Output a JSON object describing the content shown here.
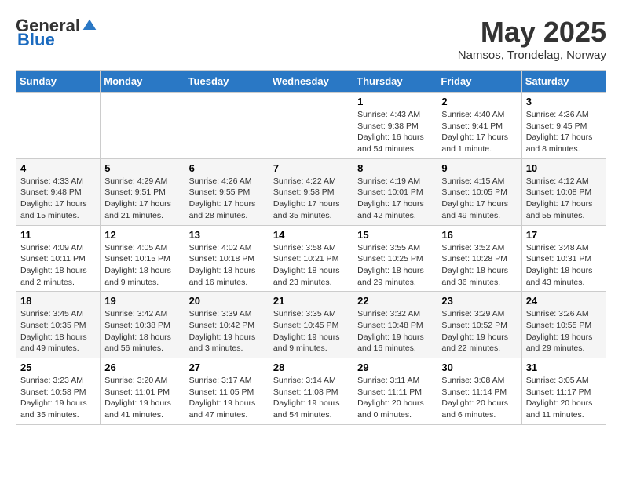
{
  "header": {
    "logo_general": "General",
    "logo_blue": "Blue",
    "month_title": "May 2025",
    "location": "Namsos, Trondelag, Norway"
  },
  "weekdays": [
    "Sunday",
    "Monday",
    "Tuesday",
    "Wednesday",
    "Thursday",
    "Friday",
    "Saturday"
  ],
  "weeks": [
    [
      {
        "day": "",
        "info": ""
      },
      {
        "day": "",
        "info": ""
      },
      {
        "day": "",
        "info": ""
      },
      {
        "day": "",
        "info": ""
      },
      {
        "day": "1",
        "info": "Sunrise: 4:43 AM\nSunset: 9:38 PM\nDaylight: 16 hours\nand 54 minutes."
      },
      {
        "day": "2",
        "info": "Sunrise: 4:40 AM\nSunset: 9:41 PM\nDaylight: 17 hours\nand 1 minute."
      },
      {
        "day": "3",
        "info": "Sunrise: 4:36 AM\nSunset: 9:45 PM\nDaylight: 17 hours\nand 8 minutes."
      }
    ],
    [
      {
        "day": "4",
        "info": "Sunrise: 4:33 AM\nSunset: 9:48 PM\nDaylight: 17 hours\nand 15 minutes."
      },
      {
        "day": "5",
        "info": "Sunrise: 4:29 AM\nSunset: 9:51 PM\nDaylight: 17 hours\nand 21 minutes."
      },
      {
        "day": "6",
        "info": "Sunrise: 4:26 AM\nSunset: 9:55 PM\nDaylight: 17 hours\nand 28 minutes."
      },
      {
        "day": "7",
        "info": "Sunrise: 4:22 AM\nSunset: 9:58 PM\nDaylight: 17 hours\nand 35 minutes."
      },
      {
        "day": "8",
        "info": "Sunrise: 4:19 AM\nSunset: 10:01 PM\nDaylight: 17 hours\nand 42 minutes."
      },
      {
        "day": "9",
        "info": "Sunrise: 4:15 AM\nSunset: 10:05 PM\nDaylight: 17 hours\nand 49 minutes."
      },
      {
        "day": "10",
        "info": "Sunrise: 4:12 AM\nSunset: 10:08 PM\nDaylight: 17 hours\nand 55 minutes."
      }
    ],
    [
      {
        "day": "11",
        "info": "Sunrise: 4:09 AM\nSunset: 10:11 PM\nDaylight: 18 hours\nand 2 minutes."
      },
      {
        "day": "12",
        "info": "Sunrise: 4:05 AM\nSunset: 10:15 PM\nDaylight: 18 hours\nand 9 minutes."
      },
      {
        "day": "13",
        "info": "Sunrise: 4:02 AM\nSunset: 10:18 PM\nDaylight: 18 hours\nand 16 minutes."
      },
      {
        "day": "14",
        "info": "Sunrise: 3:58 AM\nSunset: 10:21 PM\nDaylight: 18 hours\nand 23 minutes."
      },
      {
        "day": "15",
        "info": "Sunrise: 3:55 AM\nSunset: 10:25 PM\nDaylight: 18 hours\nand 29 minutes."
      },
      {
        "day": "16",
        "info": "Sunrise: 3:52 AM\nSunset: 10:28 PM\nDaylight: 18 hours\nand 36 minutes."
      },
      {
        "day": "17",
        "info": "Sunrise: 3:48 AM\nSunset: 10:31 PM\nDaylight: 18 hours\nand 43 minutes."
      }
    ],
    [
      {
        "day": "18",
        "info": "Sunrise: 3:45 AM\nSunset: 10:35 PM\nDaylight: 18 hours\nand 49 minutes."
      },
      {
        "day": "19",
        "info": "Sunrise: 3:42 AM\nSunset: 10:38 PM\nDaylight: 18 hours\nand 56 minutes."
      },
      {
        "day": "20",
        "info": "Sunrise: 3:39 AM\nSunset: 10:42 PM\nDaylight: 19 hours\nand 3 minutes."
      },
      {
        "day": "21",
        "info": "Sunrise: 3:35 AM\nSunset: 10:45 PM\nDaylight: 19 hours\nand 9 minutes."
      },
      {
        "day": "22",
        "info": "Sunrise: 3:32 AM\nSunset: 10:48 PM\nDaylight: 19 hours\nand 16 minutes."
      },
      {
        "day": "23",
        "info": "Sunrise: 3:29 AM\nSunset: 10:52 PM\nDaylight: 19 hours\nand 22 minutes."
      },
      {
        "day": "24",
        "info": "Sunrise: 3:26 AM\nSunset: 10:55 PM\nDaylight: 19 hours\nand 29 minutes."
      }
    ],
    [
      {
        "day": "25",
        "info": "Sunrise: 3:23 AM\nSunset: 10:58 PM\nDaylight: 19 hours\nand 35 minutes."
      },
      {
        "day": "26",
        "info": "Sunrise: 3:20 AM\nSunset: 11:01 PM\nDaylight: 19 hours\nand 41 minutes."
      },
      {
        "day": "27",
        "info": "Sunrise: 3:17 AM\nSunset: 11:05 PM\nDaylight: 19 hours\nand 47 minutes."
      },
      {
        "day": "28",
        "info": "Sunrise: 3:14 AM\nSunset: 11:08 PM\nDaylight: 19 hours\nand 54 minutes."
      },
      {
        "day": "29",
        "info": "Sunrise: 3:11 AM\nSunset: 11:11 PM\nDaylight: 20 hours\nand 0 minutes."
      },
      {
        "day": "30",
        "info": "Sunrise: 3:08 AM\nSunset: 11:14 PM\nDaylight: 20 hours\nand 6 minutes."
      },
      {
        "day": "31",
        "info": "Sunrise: 3:05 AM\nSunset: 11:17 PM\nDaylight: 20 hours\nand 11 minutes."
      }
    ]
  ]
}
